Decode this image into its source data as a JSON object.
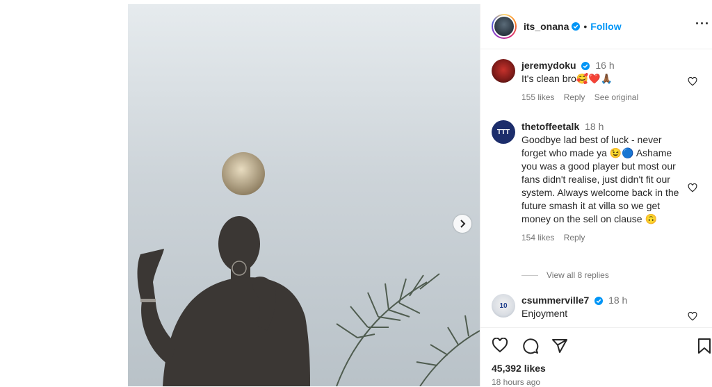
{
  "post": {
    "username": "its_onana",
    "follow_label": "Follow",
    "likes_label": "45,392 likes",
    "time_ago": "18 hours ago"
  },
  "comments": [
    {
      "user": "jeremydoku",
      "verified": true,
      "time": "16 h",
      "text": "It's clean bro🥰❤️🙏🏾",
      "likes": "155 likes",
      "reply": "Reply",
      "see_original": "See original"
    },
    {
      "user": "thetoffeetalk",
      "verified": false,
      "time": "18 h",
      "text": "Goodbye lad best of luck - never forget who made ya 😉🔵 Ashame you was a good player but most our fans didn't realise, just didn't fit our system. Always welcome back in the future smash it at villa so we get money on the sell on clause 🙃",
      "likes": "154 likes",
      "reply": "Reply",
      "view_replies": "View all 8 replies"
    },
    {
      "user": "csummerville7",
      "verified": true,
      "time": "18 h",
      "text": "Enjoyment"
    }
  ],
  "avatar_labels": {
    "thetoffeetalk": "TTT",
    "csummerville7": "10"
  },
  "colors": {
    "accent": "#0095f6",
    "muted": "#737373"
  }
}
